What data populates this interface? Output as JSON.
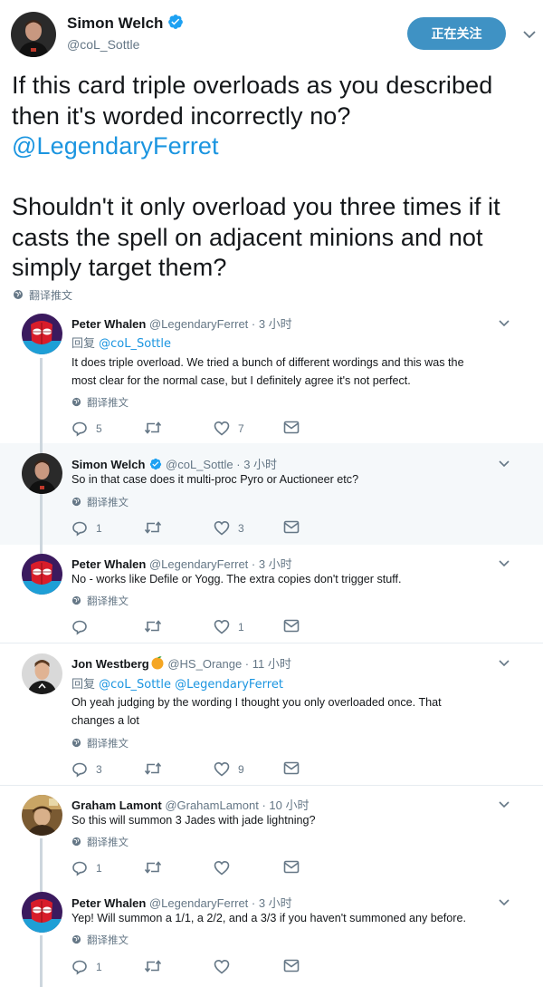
{
  "main": {
    "name": "Simon Welch",
    "handle": "@coL_Sottle",
    "follow_label": "正在关注",
    "lines_para1": [
      "If this card triple overloads as you described",
      "then it's worded incorrectly no?"
    ],
    "mention": "@LegendaryFerret",
    "lines_para2": [
      "Shouldn't it only overload you three times if it",
      "casts the spell on adjacent minions and not",
      "simply target them?"
    ],
    "translate_label": "翻译推文"
  },
  "replies": [
    {
      "name": "Peter Whalen",
      "meta": "@LegendaryFerret · 3 小时",
      "reply_prefix": "回复 ",
      "reply_to": "@coL_Sottle",
      "lines": [
        "It does triple overload.  We tried a bunch of different wordings and this was the",
        "most clear for the normal case, but I definitely agree it's not perfect."
      ],
      "translate": "翻译推文",
      "replies_count": "5",
      "retweets_count": "",
      "likes_count": "7"
    },
    {
      "name": "Simon Welch",
      "meta": "@coL_Sottle · 3 小时",
      "lines": [
        "So in that case does it multi-proc Pyro or Auctioneer etc?"
      ],
      "translate": "翻译推文",
      "replies_count": "1",
      "retweets_count": "",
      "likes_count": "3"
    },
    {
      "name": "Peter Whalen",
      "meta": "@LegendaryFerret · 3 小时",
      "lines": [
        "No - works like Defile or Yogg.  The extra copies don't trigger stuff."
      ],
      "translate": "翻译推文",
      "replies_count": "",
      "retweets_count": "",
      "likes_count": "1"
    },
    {
      "name": "Jon Westberg",
      "meta": "@HS_Orange · 11 小时",
      "reply_prefix": "回复 ",
      "reply_to": "@coL_Sottle @LegendaryFerret",
      "lines": [
        "Oh yeah judging by the wording I thought you only overloaded once. That",
        "changes a lot"
      ],
      "translate": "翻译推文",
      "replies_count": "3",
      "retweets_count": "",
      "likes_count": "9"
    },
    {
      "name": "Graham Lamont",
      "meta": "@GrahamLamont · 10 小时",
      "lines": [
        "So this will summon 3 Jades with jade lightning?"
      ],
      "translate": "翻译推文",
      "replies_count": "1",
      "retweets_count": "",
      "likes_count": ""
    },
    {
      "name": "Peter Whalen",
      "meta": "@LegendaryFerret · 3 小时",
      "lines": [
        "Yep!  Will summon a 1/1, a 2/2, and a 3/3 if you haven't summoned any before."
      ],
      "translate": "翻译推文",
      "replies_count": "1",
      "retweets_count": "",
      "likes_count": ""
    }
  ],
  "colors": {
    "accent": "#1b95e0",
    "follow_button": "#3f92c4",
    "secondary_text": "#657786",
    "highlight_row": "#f5f8fa",
    "orange_emoji": "#f5a623"
  },
  "icons": [
    "verified-badge-icon",
    "chevron-down-icon",
    "globe-icon",
    "reply-icon",
    "retweet-icon",
    "like-icon",
    "direct-message-icon",
    "orange-emoji-icon"
  ]
}
